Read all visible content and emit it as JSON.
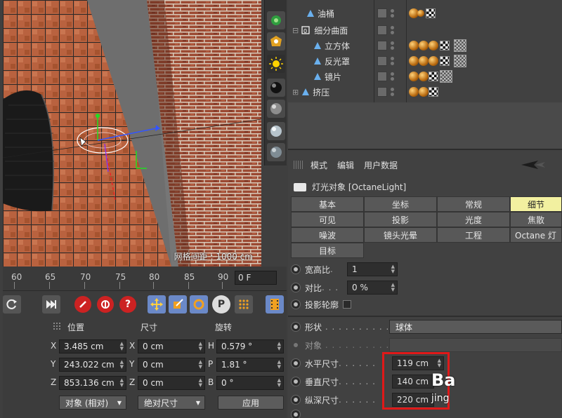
{
  "viewport": {
    "grid_spacing_label": "网格间距 : 1000 cm"
  },
  "toolstrip": {
    "items": [
      "octane-tool-icon",
      "render-tool-icon",
      "light-tool-icon",
      "sphere-material-icon",
      "sphere-gray-icon",
      "sphere-glass-icon",
      "sphere-shade-icon"
    ]
  },
  "object_manager": {
    "rows": [
      {
        "name": "油桶"
      },
      {
        "name": "细分曲面"
      },
      {
        "name": "立方体"
      },
      {
        "name": "反光罩"
      },
      {
        "name": "镜片"
      },
      {
        "name": "挤压"
      }
    ]
  },
  "attribute_manager": {
    "menu": [
      "模式",
      "编辑",
      "用户数据"
    ],
    "object_title": "灯光对象 [OctaneLight]",
    "tabs": [
      {
        "label": "基本",
        "active": false
      },
      {
        "label": "坐标",
        "active": false
      },
      {
        "label": "常规",
        "active": false
      },
      {
        "label": "细节",
        "active": true
      },
      {
        "label": "可见",
        "active": false
      },
      {
        "label": "投影",
        "active": false
      },
      {
        "label": "光度",
        "active": false
      },
      {
        "label": "焦散",
        "active": false
      },
      {
        "label": "噪波",
        "active": false
      },
      {
        "label": "镜头光晕",
        "active": false
      },
      {
        "label": "工程",
        "active": false
      },
      {
        "label": "Octane 灯",
        "active": false
      },
      {
        "label": "目标",
        "active": false
      }
    ],
    "params": {
      "aspect_label": "宽高比",
      "aspect_value": "1",
      "contrast_label": "对比",
      "contrast_value": "0 %",
      "shadow_outline_label": "投影轮廓",
      "shape_label": "形状",
      "shape_value": "球体",
      "object_label": "对象",
      "width_label": "水平尺寸",
      "width_value": "119 cm",
      "height_label": "垂直尺寸",
      "height_value": "140 cm",
      "depth_label": "纵深尺寸",
      "depth_value": "220 cm"
    }
  },
  "timeline": {
    "ticks": [
      "60",
      "65",
      "70",
      "75",
      "80",
      "85",
      "90"
    ],
    "frame_value": "0 F"
  },
  "coordinates": {
    "headers": {
      "position": "位置",
      "size": "尺寸",
      "rotation": "旋转"
    },
    "position": {
      "x": "3.485 cm",
      "y": "243.022 cm",
      "z": "853.136 cm"
    },
    "size": {
      "x": "0 cm",
      "y": "0 cm",
      "z": "0 cm"
    },
    "rotation": {
      "h": "0.579 °",
      "p": "1.81 °",
      "b": "0 °"
    },
    "axes": {
      "x": "X",
      "y": "Y",
      "z": "Z",
      "h": "H",
      "p": "P",
      "b": "B"
    },
    "mode_dropdown": "对象 (相对)",
    "size_dropdown": "绝对尺寸",
    "apply_label": "应用"
  },
  "watermarks": {
    "ba": "Ba",
    "jing": "jing"
  },
  "colors": {
    "active_tab": "#f2f0a0",
    "highlight_box": "#e01919",
    "record_buttons": "#cc2222"
  }
}
